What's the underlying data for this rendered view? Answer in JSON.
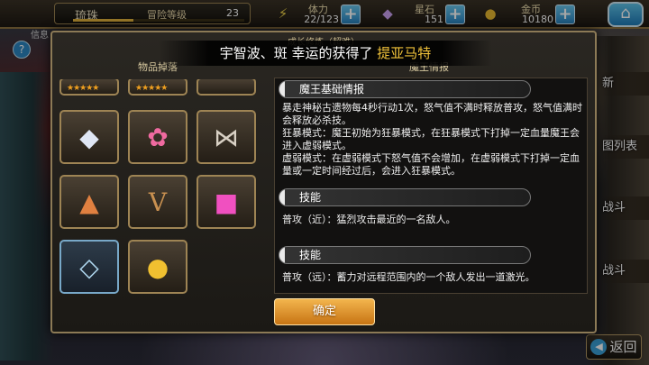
{
  "player": {
    "name": "琉珠",
    "level_label": "冒险等级",
    "level": "23",
    "exp_fraction": 0.35
  },
  "resources": [
    {
      "icon": "stamina-icon",
      "glyph": "⚡",
      "label": "体力",
      "value": "22/123",
      "color": "#f2d64a"
    },
    {
      "icon": "star-stone-icon",
      "glyph": "◆",
      "label": "星石",
      "value": "151",
      "color": "#c9a0f0"
    },
    {
      "icon": "gold-coin-icon",
      "glyph": "●",
      "label": "金币",
      "value": "10180",
      "color": "#e8b830"
    }
  ],
  "left_labels": {
    "info": "信息"
  },
  "side_menu": {
    "refresh": "新",
    "list": "图列表",
    "battle1": "战斗",
    "battle2": "战斗"
  },
  "back_label": "返回",
  "modal": {
    "title": "成长修炼（超难）",
    "left_section": "物品掉落",
    "right_section": "魔王情报",
    "toast_prefix": "宇智波、斑 幸运的获得了",
    "toast_item": "提亚马特",
    "confirm": "确定"
  },
  "items": [
    {
      "name": "star-card-item",
      "glyph": "",
      "stars": "★★★★★",
      "partial": true
    },
    {
      "name": "star-card-item-2",
      "glyph": "",
      "stars": "★★★★★",
      "partial": true
    },
    {
      "name": "card-item-3",
      "glyph": "",
      "stars": "",
      "partial": true
    },
    {
      "name": "diamond-item",
      "glyph": "💎",
      "color": "#d8e0f0"
    },
    {
      "name": "pink-ribbon-item",
      "glyph": "🎀",
      "color": "#f06aa0"
    },
    {
      "name": "black-ribbon-item",
      "glyph": "🎀",
      "color": "#d0c8c0"
    },
    {
      "name": "ore-item",
      "glyph": "▲",
      "color": "#e08040"
    },
    {
      "name": "horn-item",
      "glyph": "V",
      "color": "#c89050"
    },
    {
      "name": "pink-box-item",
      "glyph": "■",
      "color": "#f050c0"
    },
    {
      "name": "crystal-item",
      "glyph": "◆",
      "color": "#b0d8f0",
      "blue": true
    },
    {
      "name": "gold-coins-item",
      "glyph": "●",
      "color": "#f0c030"
    }
  ],
  "info": {
    "base_header": "魔王基础情报",
    "base_text": "暴走神秘古遗物每4秒行动1次，怒气值不满时释放普攻，怒气值满时会释放必杀技。\n狂暴模式：魔王初始为狂暴模式，在狂暴模式下打掉一定血量魔王会进入虚弱模式。\n虚弱模式：在虚弱模式下怒气值不会增加，在虚弱模式下打掉一定血量或一定时间经过后，会进入狂暴模式。",
    "skill1_header": "技能",
    "skill1_text": "普攻（近）：猛烈攻击最近的一名敌人。",
    "skill2_header": "技能",
    "skill2_text": "普攻（远）：蓄力对远程范围内的一个敌人发出一道激光。"
  }
}
